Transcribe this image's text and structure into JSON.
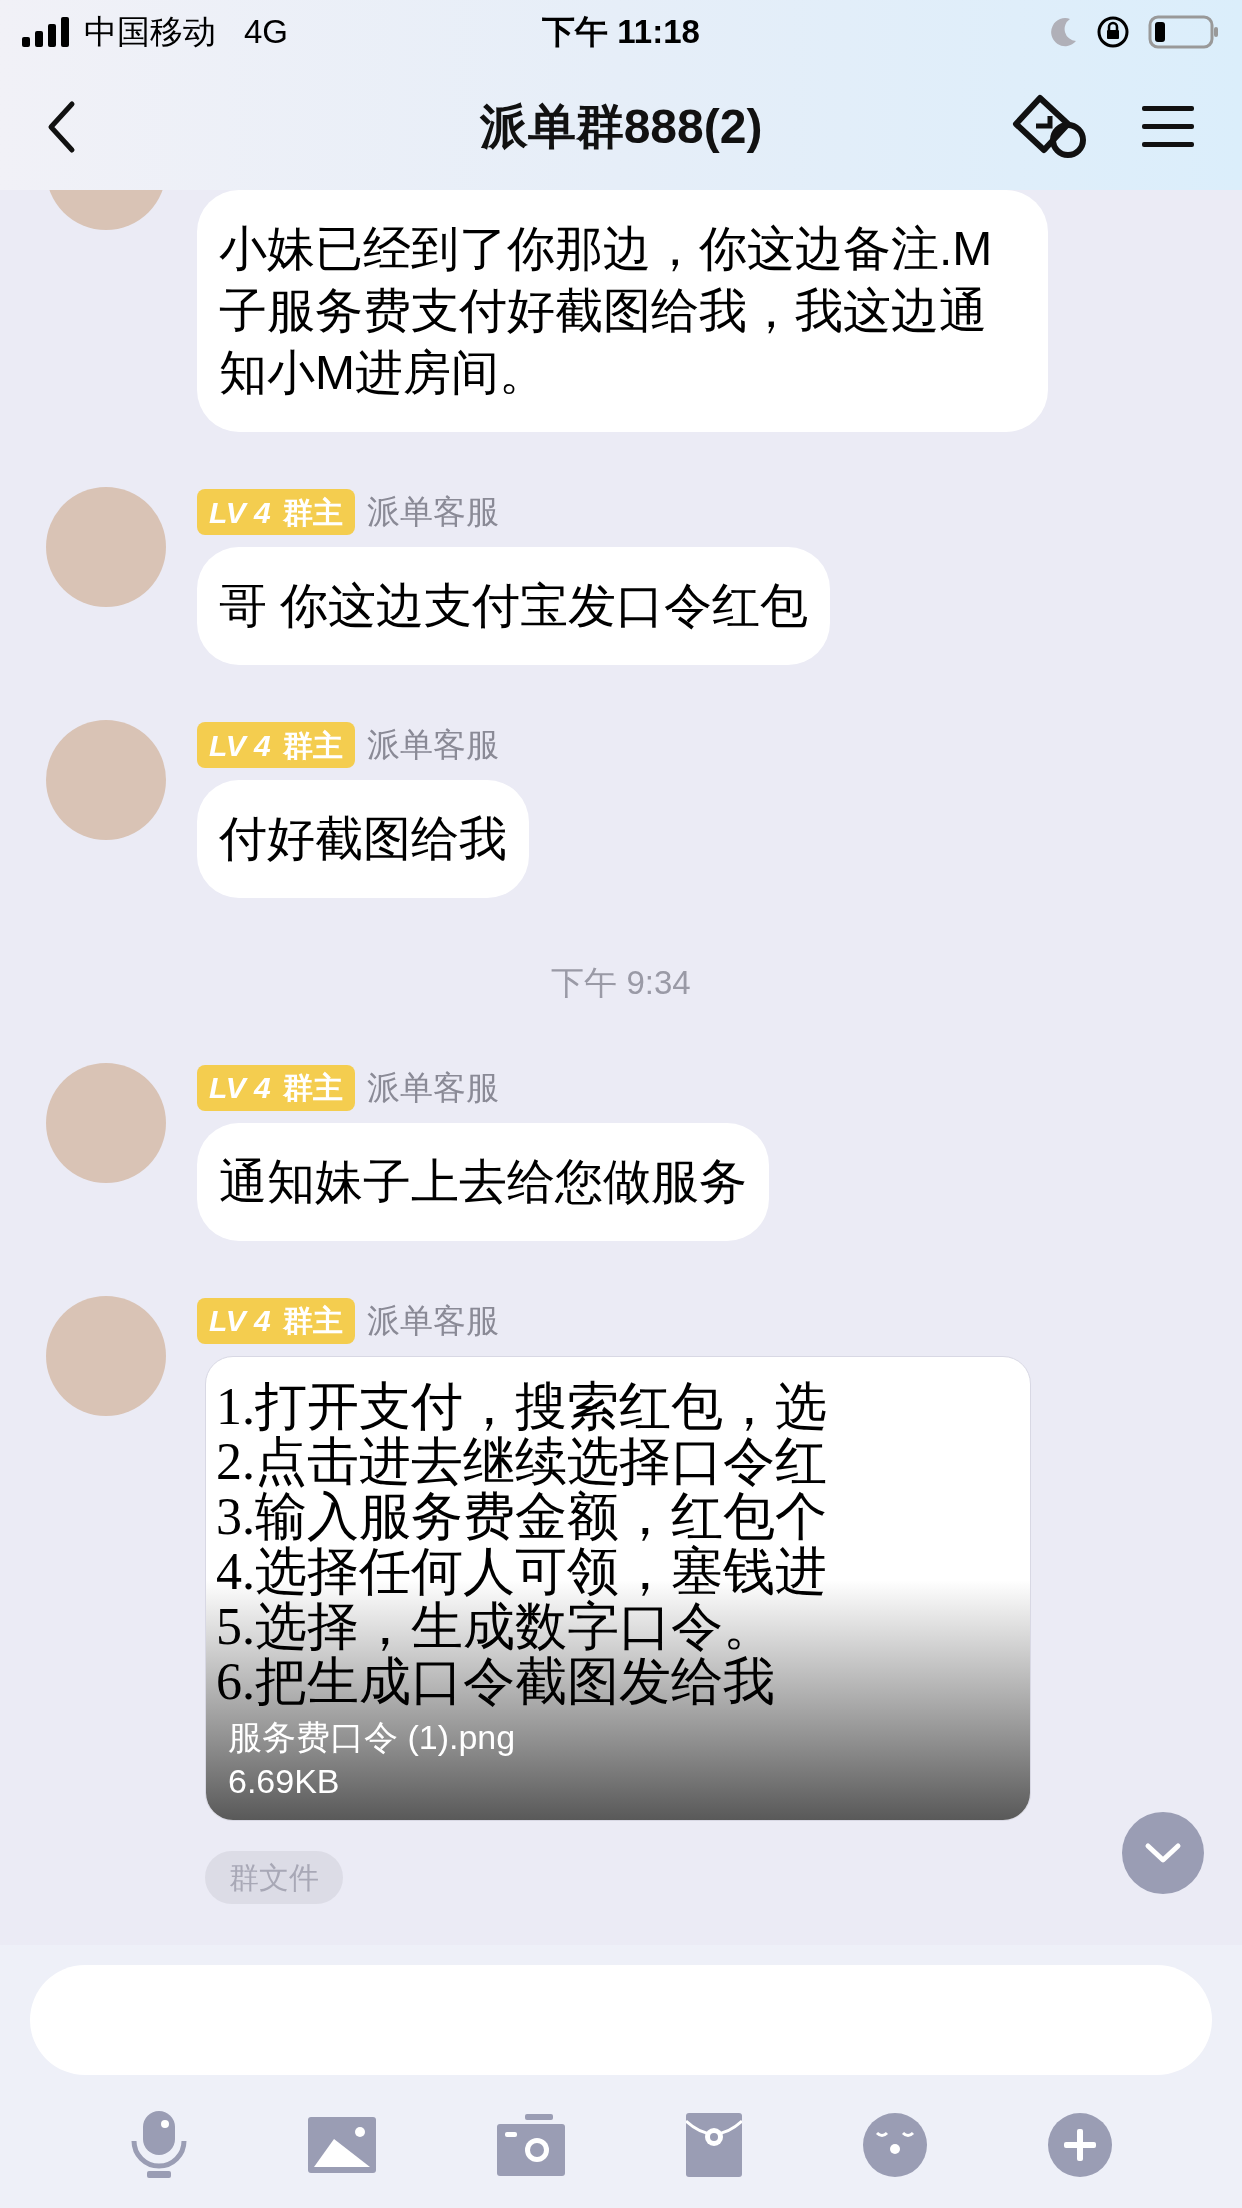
{
  "status_bar": {
    "carrier": "中国移动",
    "network": "4G",
    "time": "下午 11:18"
  },
  "header": {
    "title": "派单群888(2)"
  },
  "messages": [
    {
      "kind": "text",
      "text": "小妹已经到了你那边，你这边备注.M子服务费支付好截图给我，我这边通知小M进房间。"
    },
    {
      "kind": "text",
      "badge": {
        "level": "LV 4",
        "role": "群主"
      },
      "name": "派单客服",
      "text": "哥  你这边支付宝发口令红包"
    },
    {
      "kind": "text",
      "badge": {
        "level": "LV 4",
        "role": "群主"
      },
      "name": "派单客服",
      "text": "付好截图给我"
    },
    {
      "kind": "time",
      "text": "下午 9:34"
    },
    {
      "kind": "text",
      "badge": {
        "level": "LV 4",
        "role": "群主"
      },
      "name": "派单客服",
      "text": "通知妹子上去给您做服务"
    },
    {
      "kind": "image",
      "badge": {
        "level": "LV 4",
        "role": "群主"
      },
      "name": "派单客服",
      "image_lines": [
        "1.打开支付，搜索红包，选",
        "2.点击进去继续选择口令红",
        "3.输入服务费金额，红包个",
        "4.选择任何人可领，塞钱进",
        "5.选择，生成数字口令。",
        "6.把生成口令截图发给我"
      ],
      "file_name": "服务费口令 (1).png",
      "file_size": "6.69KB"
    }
  ],
  "group_file_chip": "群文件"
}
